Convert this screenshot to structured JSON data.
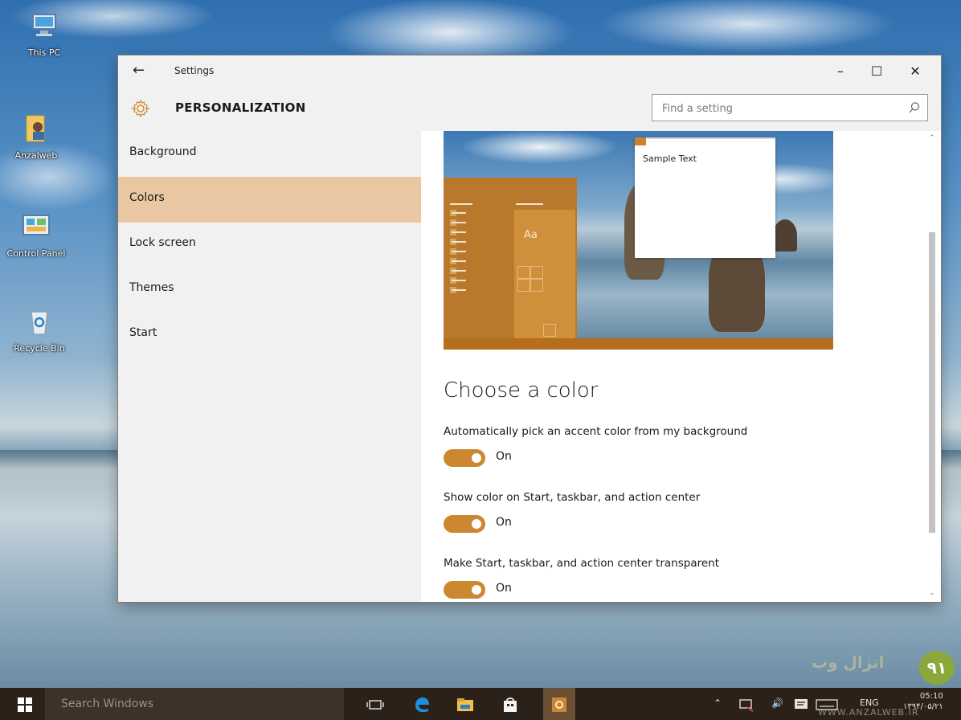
{
  "desktop": {
    "icons": [
      {
        "label": "This PC"
      },
      {
        "label": "Anzalweb"
      },
      {
        "label": "Control Panel"
      },
      {
        "label": "Recycle Bin"
      }
    ]
  },
  "window": {
    "app_title": "Settings",
    "page_title": "PERSONALIZATION",
    "search_placeholder": "Find a setting"
  },
  "sidebar": {
    "items": [
      {
        "label": "Background",
        "active": false
      },
      {
        "label": "Colors",
        "active": true
      },
      {
        "label": "Lock screen",
        "active": false
      },
      {
        "label": "Themes",
        "active": false
      },
      {
        "label": "Start",
        "active": false
      }
    ]
  },
  "preview": {
    "sample_text": "Sample Text",
    "tile_text": "Aa"
  },
  "content": {
    "heading": "Choose a color",
    "settings": [
      {
        "label": "Automatically pick an accent color from my background",
        "state": "On"
      },
      {
        "label": "Show color on Start, taskbar, and action center",
        "state": "On"
      },
      {
        "label": "Make Start, taskbar, and action center transparent",
        "state": "On"
      }
    ]
  },
  "taskbar": {
    "search_text": "Search Windows",
    "language": "ENG",
    "time": "05:10",
    "date": "۱۳۹۴/۰۵/۲۱"
  },
  "watermark": {
    "text": "انزال وب",
    "site": "WWW.ANZALWEB.IR"
  },
  "colors": {
    "accent": "#cc8831",
    "nav_active": "#e9c7a3",
    "chrome": "#f1f1f1",
    "taskbar": "#2b2118"
  }
}
